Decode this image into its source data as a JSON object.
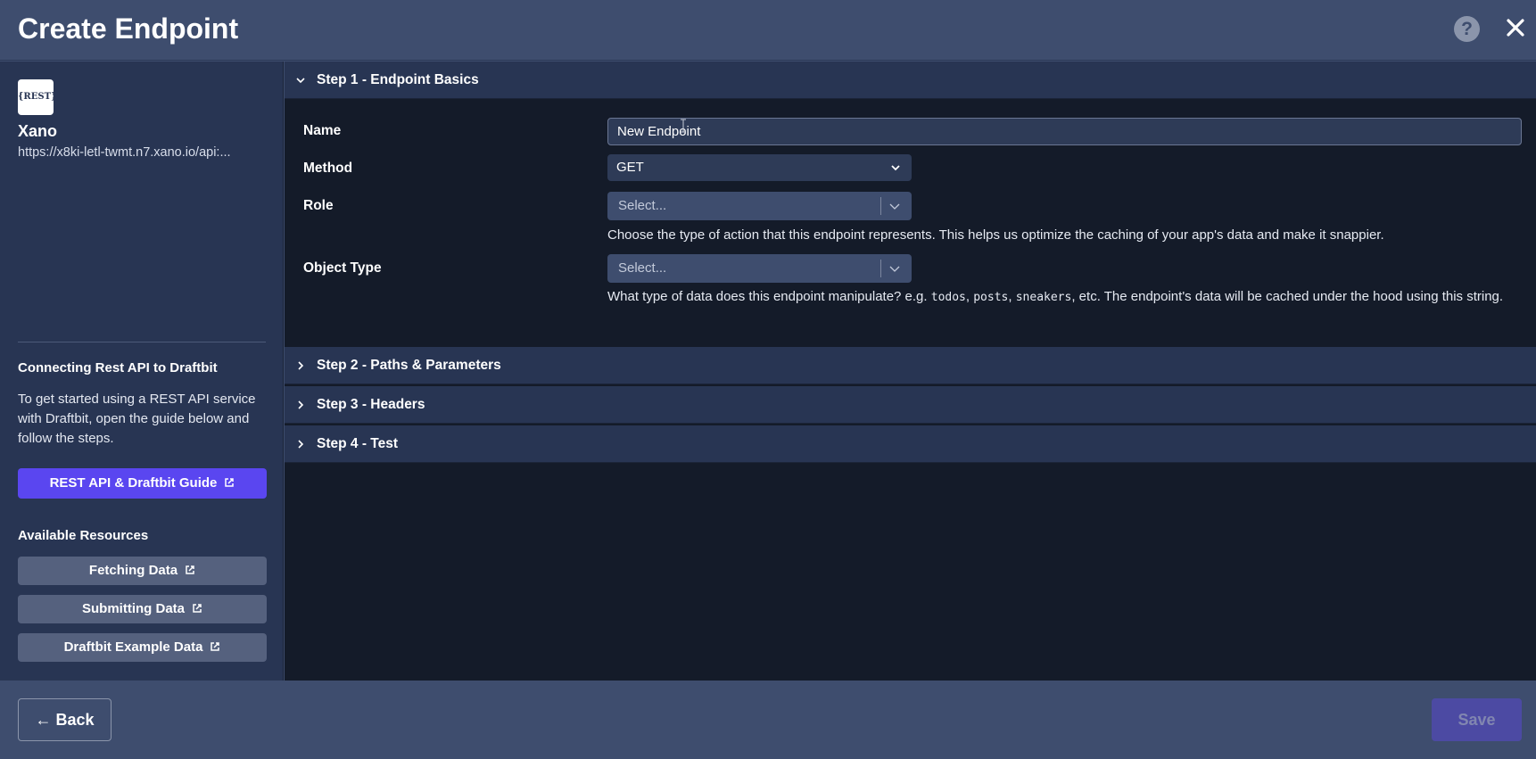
{
  "header": {
    "title": "Create Endpoint",
    "help_glyph": "?",
    "icons": [
      "question-circle-icon",
      "close-icon"
    ]
  },
  "sidebar": {
    "logo_text": "{REST}",
    "provider_name": "Xano",
    "base_url": "https://x8ki-letl-twmt.n7.xano.io/api:...",
    "guide_heading": "Connecting Rest API to Draftbit",
    "guide_text": "To get started using a REST API service with Draftbit, open the guide below and follow the steps.",
    "guide_button": "REST API & Draftbit Guide",
    "resources_heading": "Available Resources",
    "resources": [
      {
        "label": "Fetching Data"
      },
      {
        "label": "Submitting Data"
      },
      {
        "label": "Draftbit Example Data"
      }
    ]
  },
  "steps": [
    {
      "label": "Step 1 - Endpoint Basics",
      "expanded": true
    },
    {
      "label": "Step 2 - Paths & Parameters",
      "expanded": false
    },
    {
      "label": "Step 3 - Headers",
      "expanded": false
    },
    {
      "label": "Step 4 - Test",
      "expanded": false
    }
  ],
  "form": {
    "name_label": "Name",
    "name_value": "New Endpoint",
    "method_label": "Method",
    "method_value": "GET",
    "role_label": "Role",
    "role_placeholder": "Select...",
    "role_help": "Choose the type of action that this endpoint represents. This helps us optimize the caching of your app's data and make it snappier.",
    "object_type_label": "Object Type",
    "object_type_placeholder": "Select...",
    "object_help_prefix": "What type of data does this endpoint manipulate? e.g. ",
    "object_help_examples": [
      "todos",
      "posts",
      "sneakers"
    ],
    "object_help_sep": ", ",
    "object_help_suffix": ", etc. The endpoint's data will be cached under the hood using this string."
  },
  "footer": {
    "back_label": "Back",
    "save_label": "Save"
  },
  "colors": {
    "accent": "#5a46f0",
    "background": "#141b29",
    "panel": "#283553",
    "chrome": "#3e4d6e"
  }
}
